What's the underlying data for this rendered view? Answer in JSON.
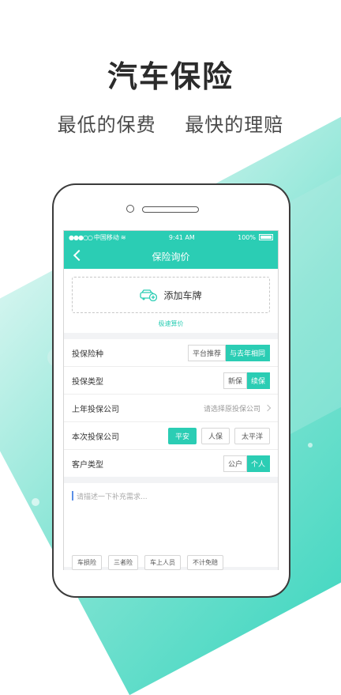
{
  "hero": {
    "title": "汽车保险",
    "subtitle_left": "最低的保费",
    "subtitle_right": "最快的理赔"
  },
  "statusbar": {
    "carrier": "中国移动",
    "time": "9:41 AM",
    "battery": "100%"
  },
  "navbar": {
    "title": "保险询价"
  },
  "plate": {
    "add_label": "添加车牌",
    "quick_link": "极速算价"
  },
  "form": {
    "insurance_type": {
      "label": "投保险种",
      "options": [
        "平台推荐",
        "与去年相同"
      ],
      "selected": 1
    },
    "policy_type": {
      "label": "投保类型",
      "options": [
        "新保",
        "续保"
      ],
      "selected": 1
    },
    "last_company": {
      "label": "上年投保公司",
      "placeholder": "请选择原投保公司"
    },
    "current_company": {
      "label": "本次投保公司",
      "options": [
        "平安",
        "人保",
        "太平洋"
      ],
      "selected": 0
    },
    "customer_type": {
      "label": "客户类型",
      "options": [
        "公户",
        "个人"
      ],
      "selected": 1
    }
  },
  "notes": {
    "placeholder": "请描述一下补充需求...",
    "tags": [
      "车损险",
      "三者险",
      "车上人员",
      "不计免赔"
    ]
  },
  "colors": {
    "accent": "#2bcdb4"
  }
}
